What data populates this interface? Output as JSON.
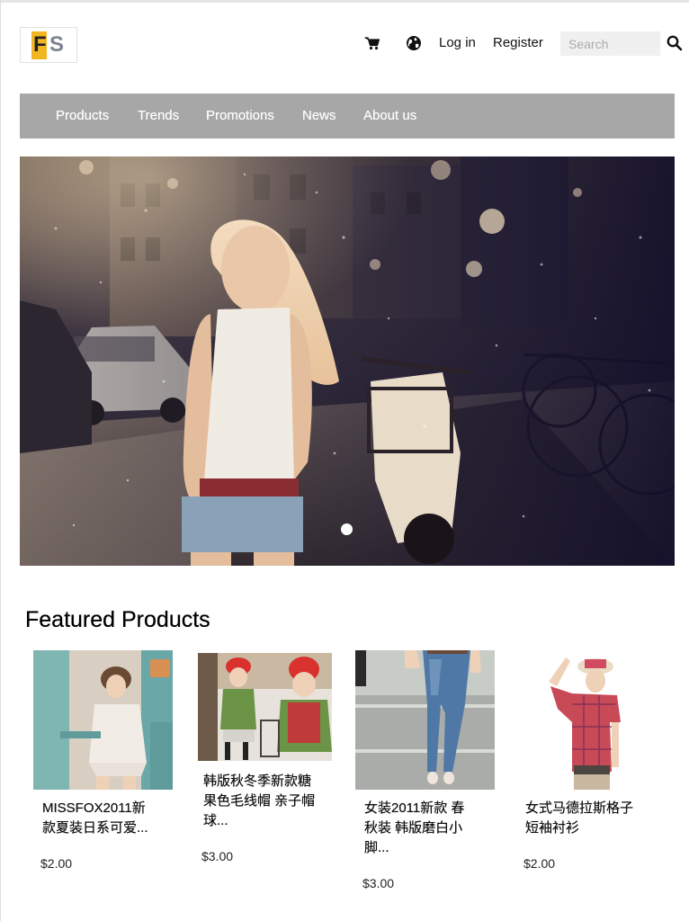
{
  "header": {
    "logo_text": "FS",
    "logo_letters": [
      "F",
      "S"
    ],
    "links": {
      "cart_icon": "shopping-cart-icon",
      "language_icon": "globe-icon",
      "login": "Log in",
      "register": "Register"
    },
    "search": {
      "placeholder": "Search",
      "value": "",
      "icon": "search-icon"
    }
  },
  "nav": {
    "items": [
      {
        "label": "Products"
      },
      {
        "label": "Trends"
      },
      {
        "label": "Promotions"
      },
      {
        "label": "News"
      },
      {
        "label": "About us"
      }
    ]
  },
  "hero": {
    "slides": 1,
    "active_slide": 1
  },
  "featured": {
    "title": "Featured Products",
    "products": [
      {
        "name": "MISSFOX2011新\n款夏装日系可爱...",
        "price": "$2.00"
      },
      {
        "name": "韩版秋冬季新款糖\n果色毛线帽 亲子帽\n球...",
        "price": "$3.00"
      },
      {
        "name": "女装2011新款 春\n秋装 韩版磨白小\n脚...",
        "price": "$3.00"
      },
      {
        "name": "女式马德拉斯格子\n短袖衬衫",
        "price": "$2.00"
      }
    ]
  },
  "colors": {
    "nav_background": "#a7a7a7",
    "logo_accent": "#f2b622",
    "search_background": "#f0f0f0"
  }
}
